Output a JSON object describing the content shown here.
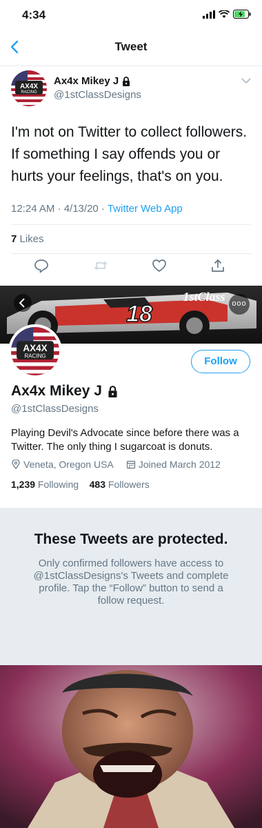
{
  "status_bar": {
    "time": "4:34"
  },
  "nav": {
    "title": "Tweet"
  },
  "tweet": {
    "author_name": "Ax4x Mikey J",
    "author_handle": "@1stClassDesigns",
    "text": "I'm not on Twitter to collect followers. If something I say offends you or hurts your feelings, that's on you.",
    "time": "12:24 AM · 4/13/20 · ",
    "app": "Twitter Web App",
    "likes_count": "7",
    "likes_label": " Likes"
  },
  "avatar_badge": {
    "line1": "AX4X",
    "line2": "RACING"
  },
  "banner": {
    "car_number": "18",
    "brand": "1stClass",
    "more_label": "ooo"
  },
  "profile": {
    "follow_label": "Follow",
    "name": "Ax4x Mikey J",
    "handle": "@1stClassDesigns",
    "bio": "Playing Devil's Advocate since before there was a Twitter. The only thing I sugarcoat is donuts.",
    "location": "Veneta, Oregon USA",
    "joined": "Joined March 2012",
    "following_count": "1,239",
    "following_label": " Following",
    "followers_count": "483",
    "followers_label": " Followers"
  },
  "protected": {
    "title": "These Tweets are protected.",
    "text": "Only confirmed followers have access to @1stClassDesigns's Tweets and complete profile. Tap the “Follow” button to send a follow request."
  },
  "icons": {
    "back": "chevron-left-icon",
    "lock": "lock-icon",
    "reply": "reply-icon",
    "retweet": "retweet-icon",
    "like": "heart-icon",
    "share": "share-icon",
    "location": "location-pin-icon",
    "calendar": "calendar-icon"
  },
  "colors": {
    "accent": "#1da1f2",
    "secondary_text": "#657786",
    "divider": "#e6ecf0"
  }
}
